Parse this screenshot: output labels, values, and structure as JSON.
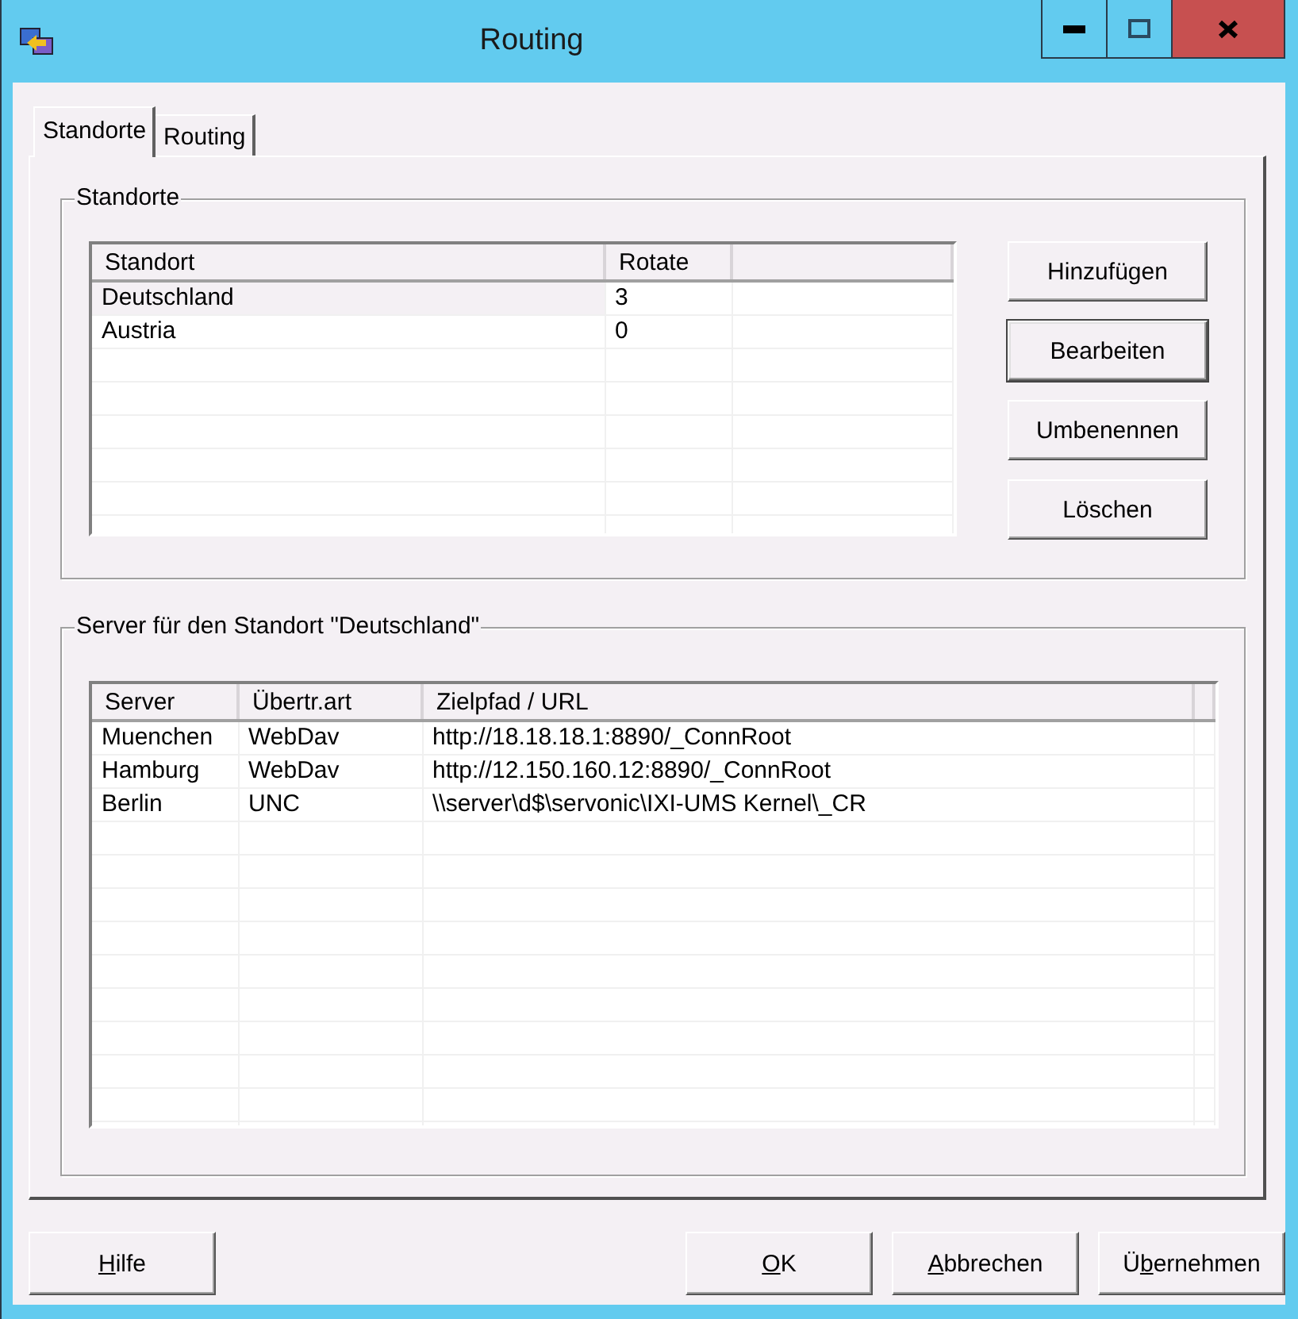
{
  "window": {
    "title": "Routing"
  },
  "tabs": [
    {
      "label": "Standorte",
      "selected": true
    },
    {
      "label": "Routing",
      "selected": false
    }
  ],
  "locations_group": {
    "title": "Standorte",
    "table": {
      "columns": [
        "Standort",
        "Rotate"
      ],
      "rows": [
        {
          "cells": [
            "Deutschland",
            "3"
          ],
          "selected": true
        },
        {
          "cells": [
            "Austria",
            "0"
          ],
          "selected": false
        }
      ]
    },
    "buttons": [
      {
        "label": "Hinzufügen",
        "default": false
      },
      {
        "label": "Bearbeiten",
        "default": true
      },
      {
        "label": "Umbenennen",
        "default": false
      },
      {
        "label": "Löschen",
        "default": false
      }
    ]
  },
  "servers_group": {
    "title": "Server für den Standort \"Deutschland\"",
    "table": {
      "columns": [
        "Server",
        "Übertr.art",
        "Zielpfad / URL"
      ],
      "rows": [
        {
          "cells": [
            "Muenchen",
            "WebDav",
            "http://18.18.18.1:8890/_ConnRoot"
          ]
        },
        {
          "cells": [
            "Hamburg",
            "WebDav",
            "http://12.150.160.12:8890/_ConnRoot"
          ]
        },
        {
          "cells": [
            "Berlin",
            "UNC",
            "\\\\server\\d$\\servonic\\IXI-UMS Kernel\\_CR"
          ]
        }
      ]
    }
  },
  "help_button": {
    "accelerator": "H",
    "after": "ilfe"
  },
  "footer_buttons": [
    {
      "accelerator": "O",
      "after": "K"
    },
    {
      "accelerator": "A",
      "after": "bbrechen"
    },
    {
      "before": "Ü",
      "accelerator": "b",
      "after": "ernehmen"
    }
  ]
}
